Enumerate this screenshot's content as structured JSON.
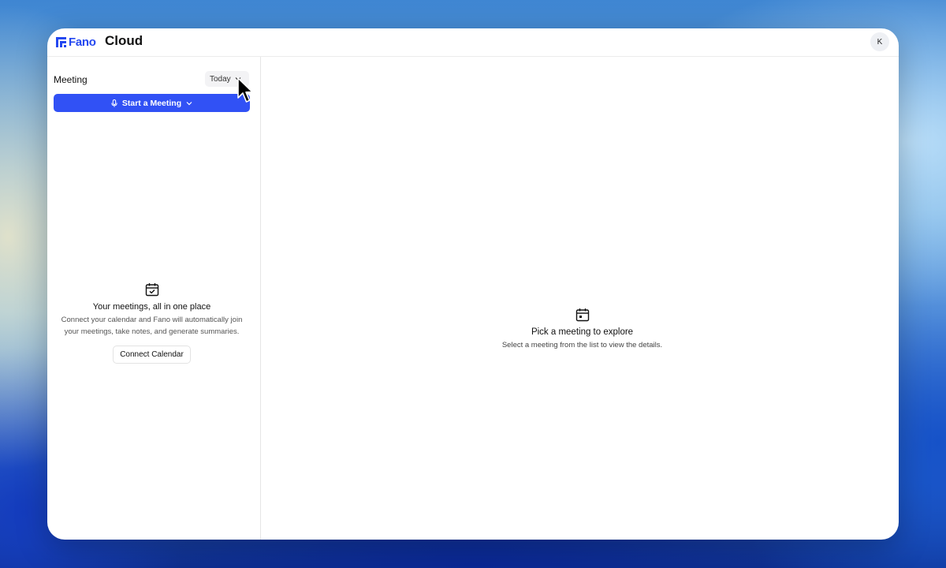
{
  "app": {
    "brand": "Fano",
    "product": "Cloud",
    "avatar_initial": "K",
    "accent_color": "#3151f5"
  },
  "sidebar": {
    "title": "Meeting",
    "filter": {
      "selected": "Today",
      "icon": "chevron-down-icon"
    },
    "start_button": {
      "label": "Start a Meeting",
      "icon": "microphone-icon"
    },
    "empty_state": {
      "icon": "calendar-check-icon",
      "heading": "Your meetings, all in one place",
      "description": "Connect your calendar and Fano will automatically join your meetings, take notes, and generate summaries.",
      "button": "Connect Calendar"
    }
  },
  "main": {
    "empty_state": {
      "icon": "calendar-icon",
      "heading": "Pick a meeting to explore",
      "description": "Select a meeting from the list to view the details."
    }
  }
}
